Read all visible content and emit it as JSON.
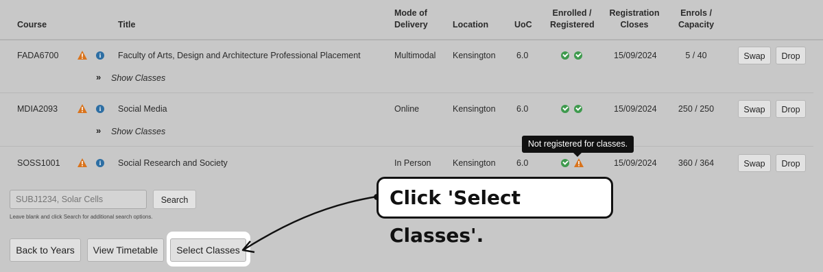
{
  "headers": {
    "course": "Course",
    "title": "Title",
    "mode": [
      "Mode of",
      "Delivery"
    ],
    "location": "Location",
    "uoc": "UoC",
    "enrolled": [
      "Enrolled /",
      "Registered"
    ],
    "closes": [
      "Registration",
      "Closes"
    ],
    "capacity": [
      "Enrols /",
      "Capacity"
    ]
  },
  "rows": [
    {
      "code": "FADA6700",
      "title": "Faculty of Arts, Design and Architecture Professional Placement",
      "mode": "Multimodal",
      "location": "Kensington",
      "uoc": "6.0",
      "closes": "15/09/2024",
      "capacity": "5 / 40",
      "show_label": "Show Classes",
      "status": [
        "enrolled",
        "registered"
      ]
    },
    {
      "code": "MDIA2093",
      "title": "Social Media",
      "mode": "Online",
      "location": "Kensington",
      "uoc": "6.0",
      "closes": "15/09/2024",
      "capacity": "250 / 250",
      "show_label": "Show Classes",
      "status": [
        "enrolled",
        "registered"
      ]
    },
    {
      "code": "SOSS1001",
      "title": "Social Research and Society",
      "mode": "In Person",
      "location": "Kensington",
      "uoc": "6.0",
      "closes": "15/09/2024",
      "capacity": "360 / 364",
      "status": [
        "enrolled",
        "not-registered"
      ]
    }
  ],
  "row_buttons": {
    "swap": "Swap",
    "drop": "Drop"
  },
  "tooltip": "Not registered for classes.",
  "search": {
    "placeholder": "SUBJ1234, Solar Cells",
    "button": "Search",
    "hint": "Leave blank and click Search for additional search options."
  },
  "bottom_buttons": {
    "back": "Back to Years",
    "timetable": "View Timetable",
    "select": "Select Classes"
  },
  "callout": "Click 'Select Classes'.",
  "colors": {
    "warning": "#d9731c",
    "info": "#2d6ea3",
    "check": "#3f9a4e",
    "background": "#c8c8c8"
  }
}
